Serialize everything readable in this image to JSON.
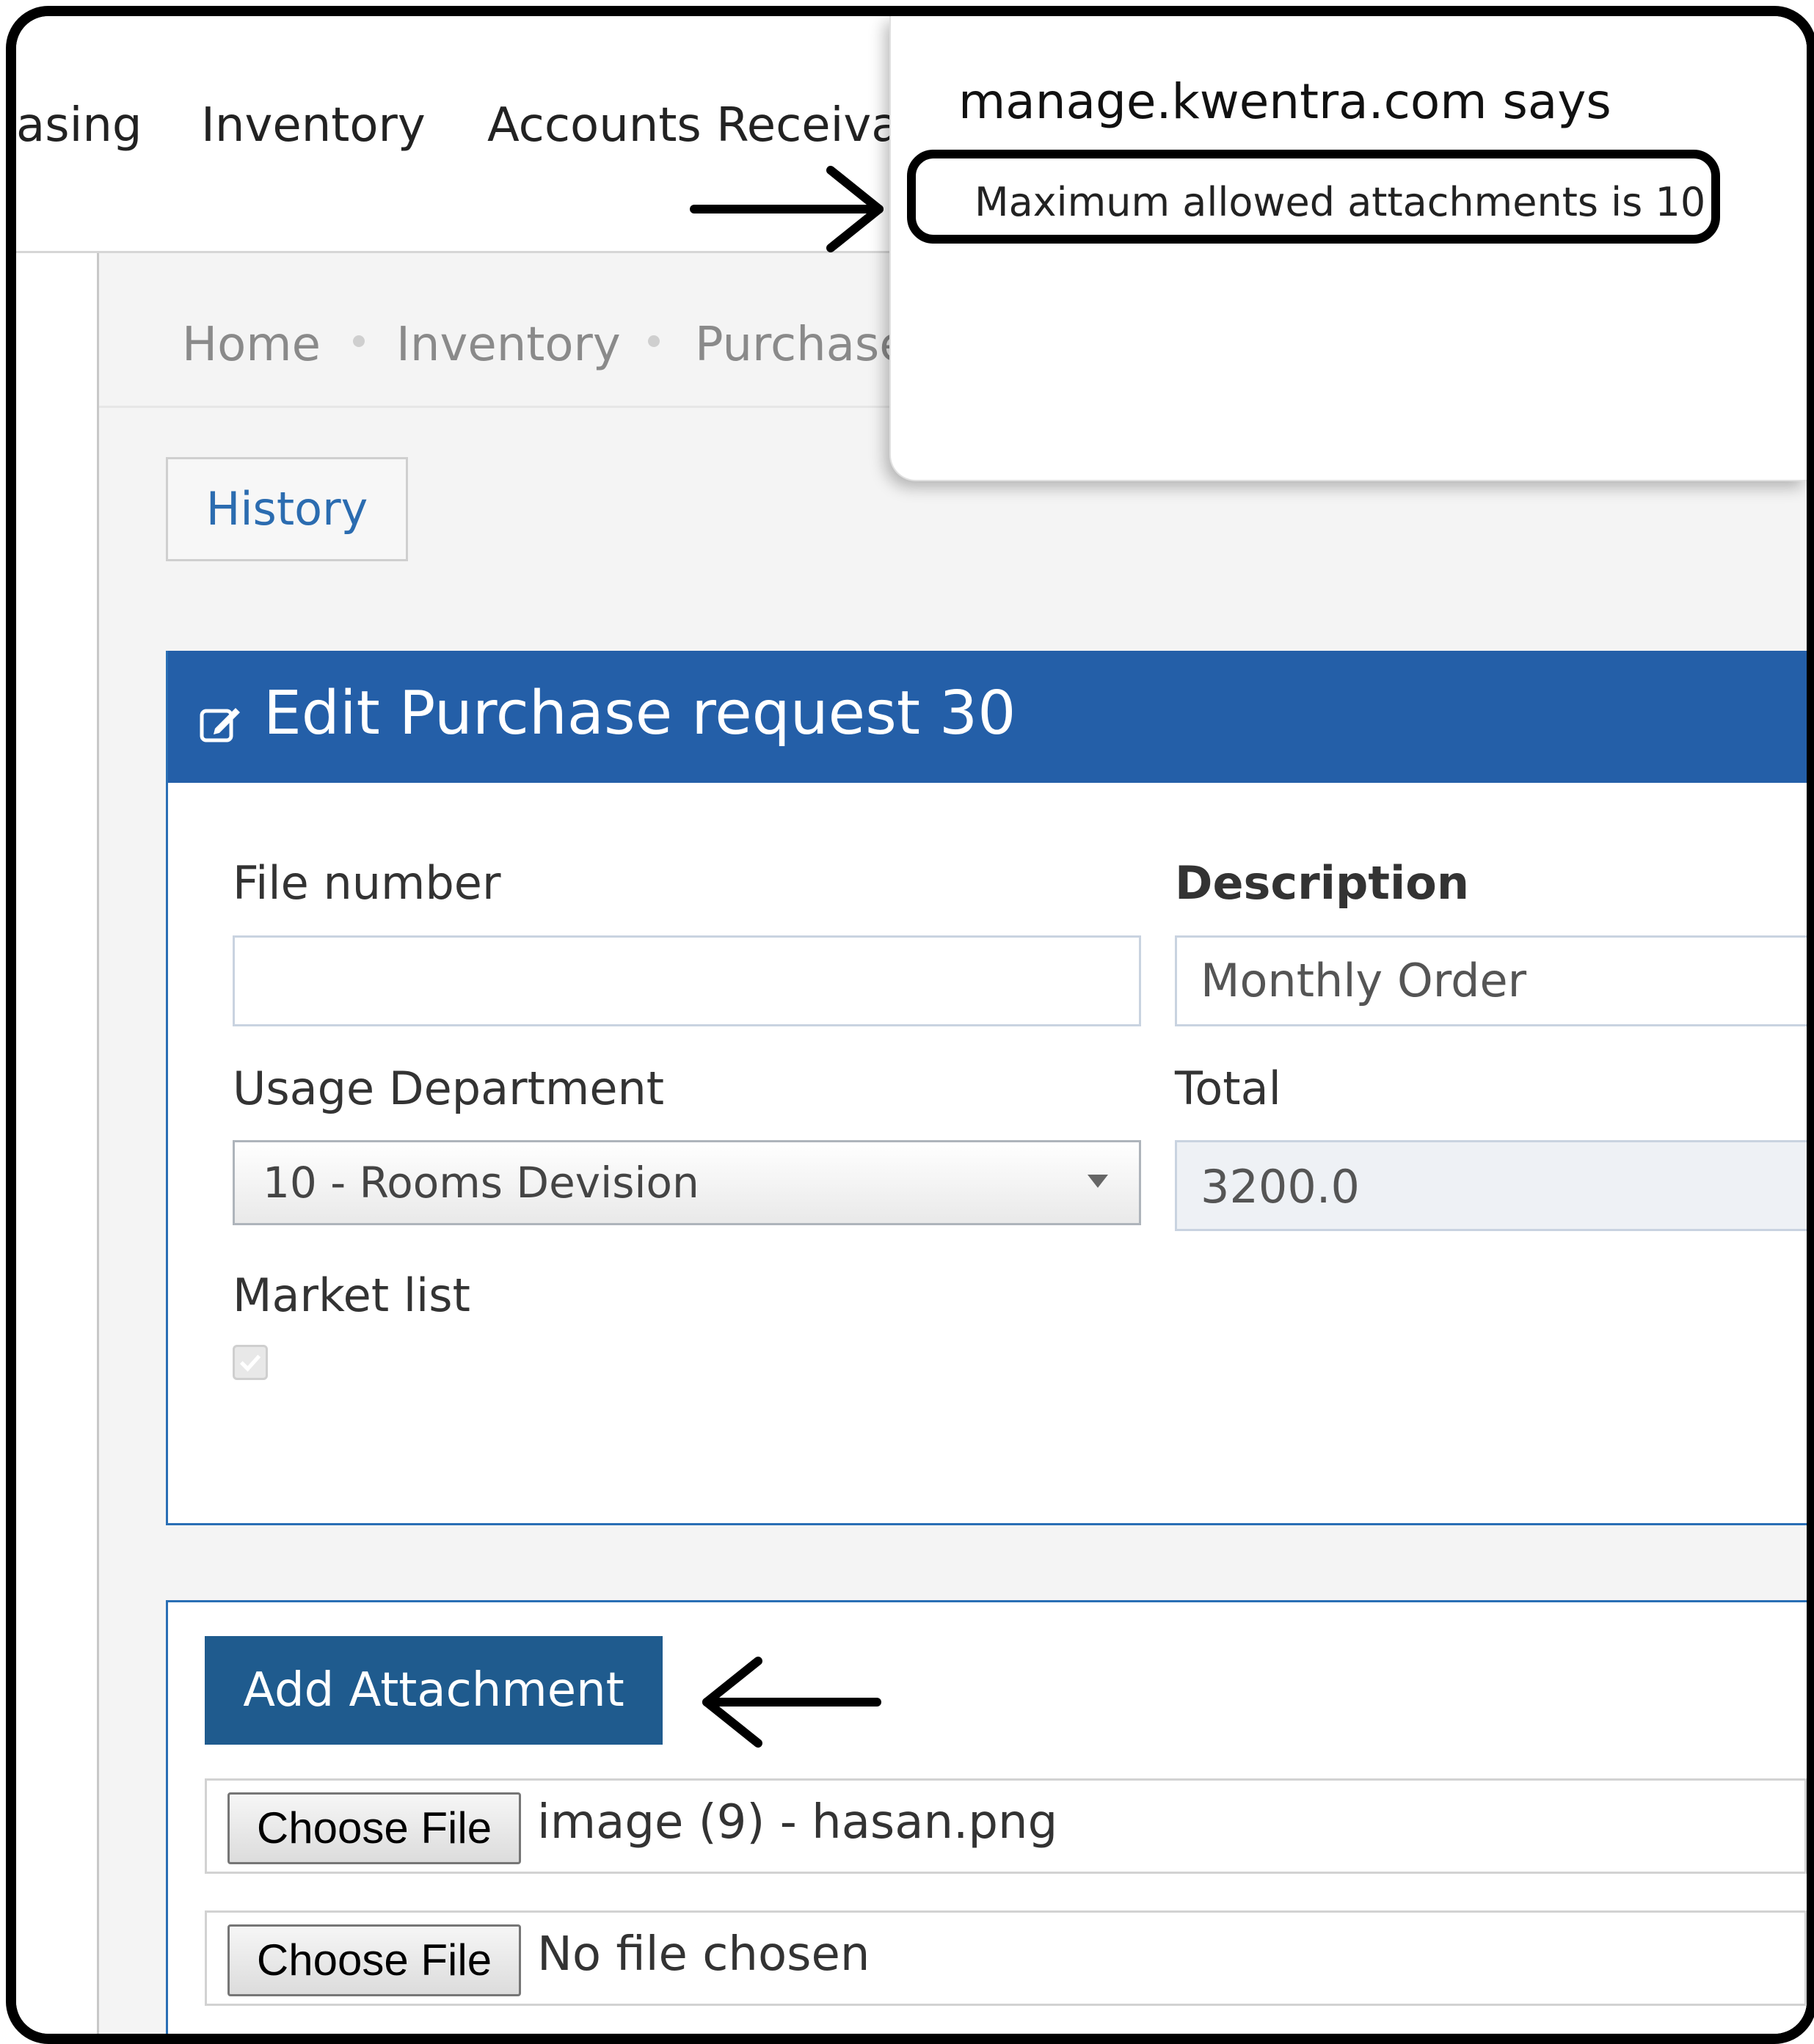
{
  "topnav": {
    "items": [
      "asing",
      "Inventory",
      "Accounts Receiva"
    ]
  },
  "breadcrumb": {
    "items": [
      "Home",
      "Inventory",
      "Purchase"
    ]
  },
  "history_button": "History",
  "panel": {
    "title": "Edit Purchase request 30",
    "icon": "edit-icon",
    "header_color": "#245fa8"
  },
  "form": {
    "file_number": {
      "label": "File number",
      "value": ""
    },
    "description": {
      "label": "Description",
      "value": "Monthly Order"
    },
    "usage_department": {
      "label": "Usage Department",
      "selected": "10 - Rooms Devision"
    },
    "total": {
      "label": "Total",
      "value": "3200.0"
    },
    "market_list": {
      "label": "Market list",
      "checked": true
    }
  },
  "attachments": {
    "add_button": "Add Attachment",
    "rows": [
      {
        "button": "Choose File",
        "file": "image (9) - hasan.png"
      },
      {
        "button": "Choose File",
        "file": "No file chosen"
      }
    ]
  },
  "dialog": {
    "title": "manage.kwentra.com says",
    "message": "Maximum allowed attachments is 10"
  }
}
